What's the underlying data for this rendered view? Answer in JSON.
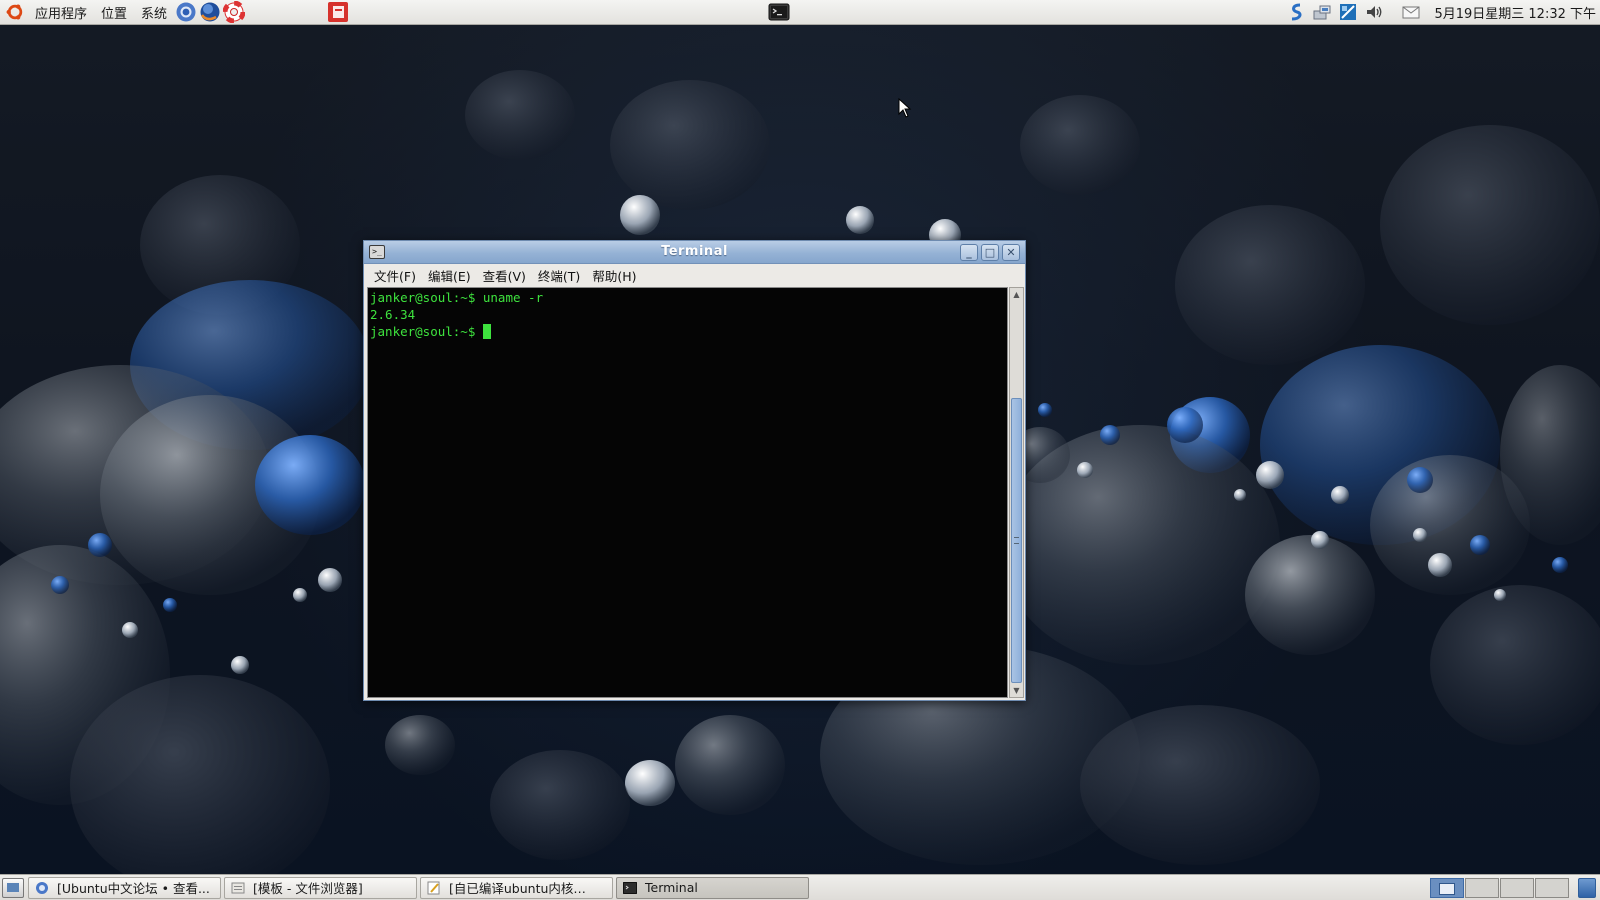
{
  "top_panel": {
    "menus": [
      "应用程序",
      "位置",
      "系统"
    ],
    "launchers": [
      "chrome-icon",
      "firefox-icon",
      "help-lifebuoy-icon"
    ],
    "extra_launcher": "red-app-icon",
    "center_icon": "terminal-icon",
    "tray": [
      "sync-icon",
      "network-icon",
      "chat-icon",
      "volume-icon",
      "mail-icon"
    ],
    "clock": "5月19日星期三 12:32 下午"
  },
  "window": {
    "title": "Terminal",
    "menus": [
      "文件(F)",
      "编辑(E)",
      "查看(V)",
      "终端(T)",
      "帮助(H)"
    ],
    "buttons": [
      "minimize",
      "maximize",
      "close"
    ]
  },
  "terminal": {
    "lines": [
      "janker@soul:~$ uname -r",
      "2.6.34",
      "janker@soul:~$ "
    ],
    "text_color": "#3ee23e",
    "background": "#050505"
  },
  "taskbar": {
    "tasks": [
      {
        "label": "[Ubuntu中文论坛 • 查看...",
        "icon": "browser-icon",
        "active": false
      },
      {
        "label": "[模板 - 文件浏览器]",
        "icon": "folder-icon",
        "active": false
      },
      {
        "label": "[自已编译ubuntu内核…",
        "icon": "text-editor-icon",
        "active": false
      },
      {
        "label": "Terminal",
        "icon": "terminal-icon",
        "active": true
      }
    ],
    "workspace_count": 4,
    "active_workspace": 1
  },
  "colors": {
    "titlebar": "#95b2d5",
    "wallpaper_accent": "#2f6fc4"
  }
}
